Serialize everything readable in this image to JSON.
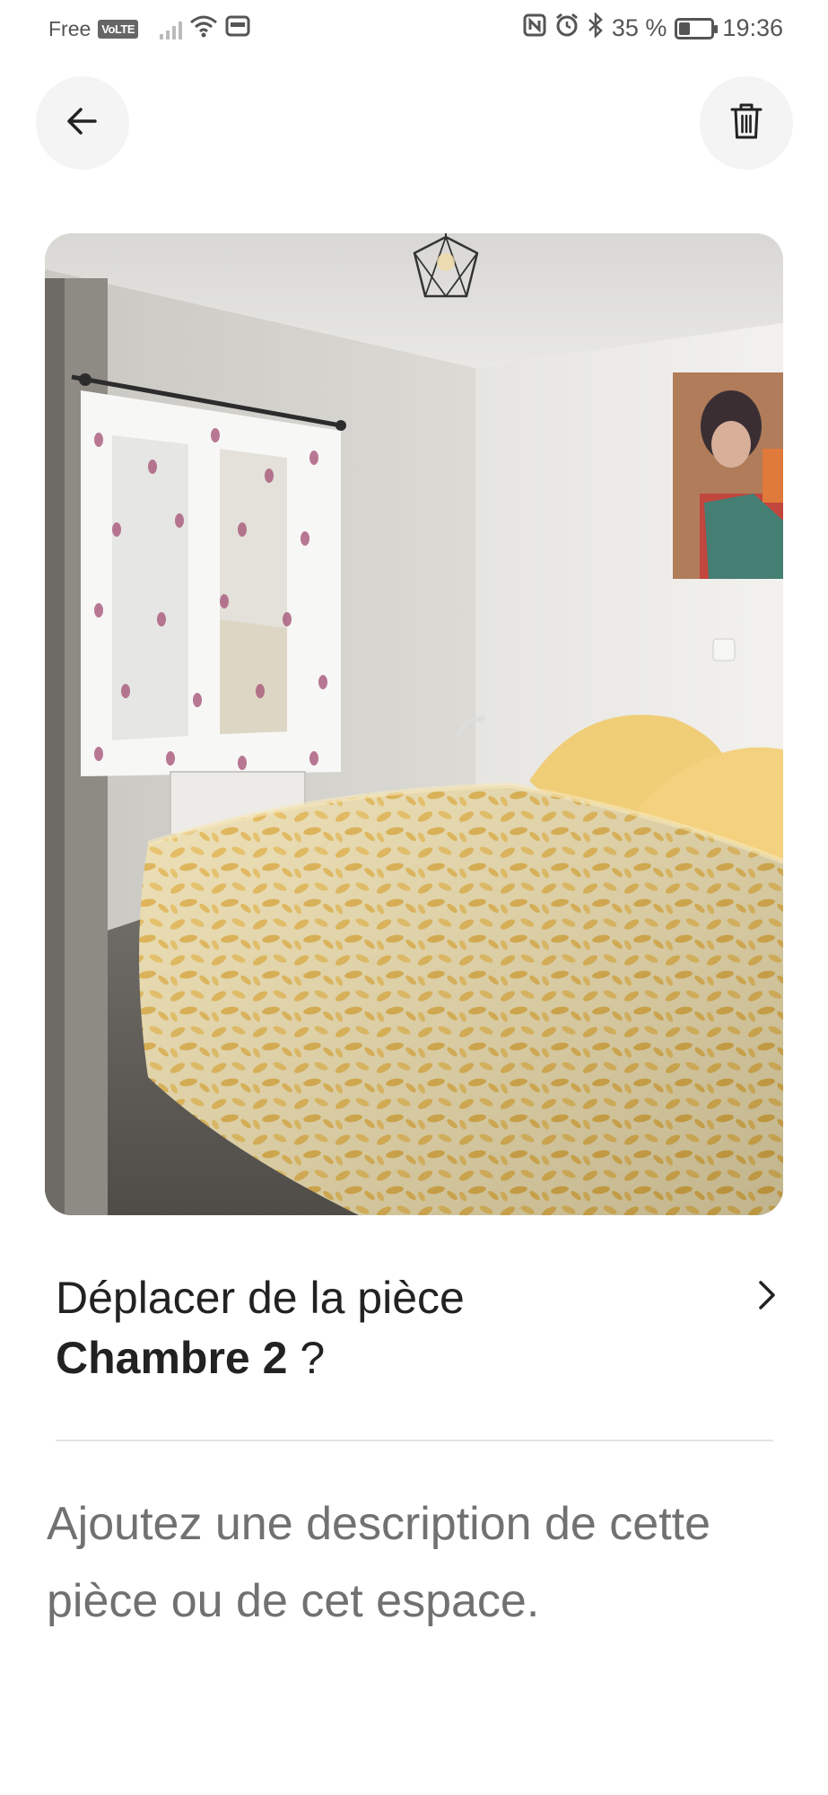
{
  "status_bar": {
    "carrier": "Free",
    "volte": "VoLTE",
    "battery_percent": "35 %",
    "battery_level": 0.35,
    "time": "19:36",
    "icons": [
      "signal-icon",
      "wifi-icon",
      "sim-icon",
      "nfc-icon",
      "alarm-icon",
      "bluetooth-icon",
      "battery-icon"
    ]
  },
  "header": {
    "back_icon": "arrow-left-icon",
    "delete_icon": "trash-icon"
  },
  "photo": {
    "subject": "bedroom"
  },
  "move_room": {
    "prefix": "Déplacer de la pièce",
    "room_name": "Chambre 2",
    "suffix": " ?",
    "icon": "chevron-right-icon"
  },
  "description": {
    "placeholder": "Ajoutez une description de cette pièce ou de cet espace."
  },
  "colors": {
    "text": "#222222",
    "muted": "#717171",
    "button_bg": "#f4f4f4",
    "divider": "#e4e4e4"
  }
}
